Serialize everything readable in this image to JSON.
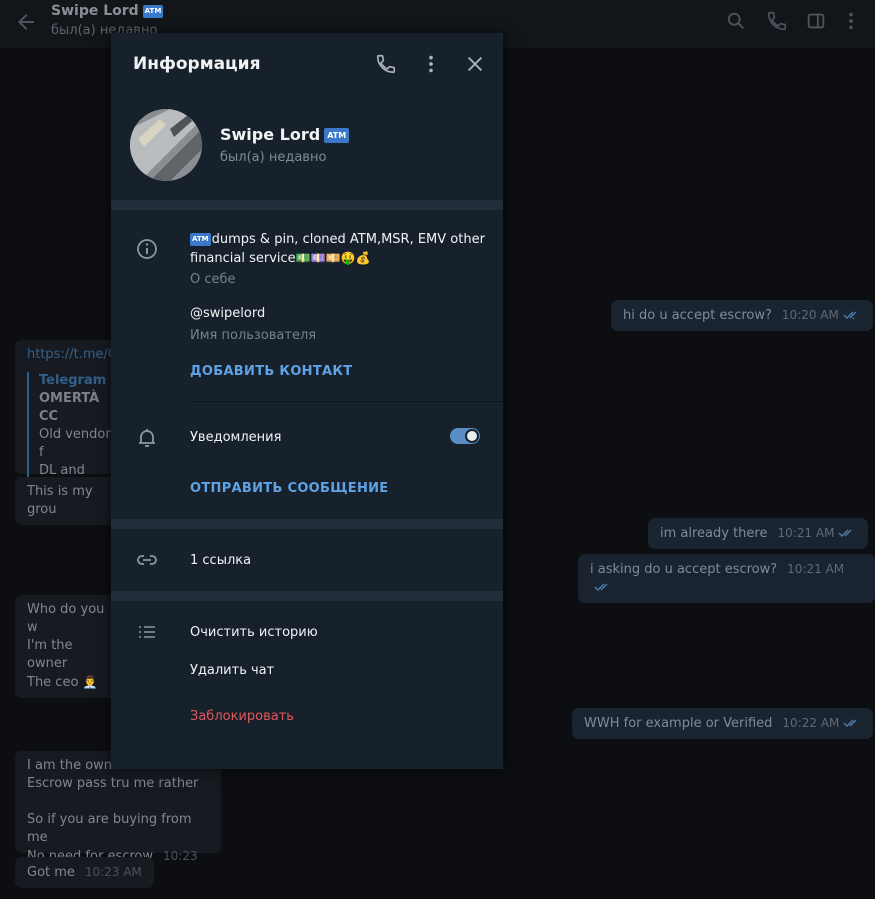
{
  "header": {
    "title": "Swipe Lord",
    "title_badge": "ATM",
    "status": "был(а) недавно",
    "icons": [
      "back-arrow-icon",
      "search-icon",
      "phone-icon",
      "sidebar-icon",
      "more-vertical-icon"
    ]
  },
  "messages": {
    "in": [
      {
        "link": "https://t.me/C",
        "preview_site": "Telegram",
        "preview_title": "OMERTÀ CC",
        "preview_line1": "Old vendor f",
        "preview_line2": "DL and Dum"
      },
      {
        "text": "This is my grou"
      },
      {
        "text": "Who do you w"
      },
      {
        "text": "I'm the owner"
      },
      {
        "text": "The ceo",
        "emoji": "👨‍💼"
      },
      {
        "line1": "I am the owner here",
        "line2": "Escrow pass tru me rather",
        "line3": "So if you are buying from me",
        "line4": "No need for escrow",
        "time": "10:23 AM"
      },
      {
        "text": "Got me",
        "time": "10:23 AM"
      }
    ],
    "out": [
      {
        "text": "hi do u accept escrow?",
        "time": "10:20 AM"
      },
      {
        "text": "im already there",
        "time": "10:21 AM"
      },
      {
        "text": "i asking do u accept escrow?",
        "time": "10:21 AM"
      },
      {
        "text": "WWH for example or Verified",
        "time": "10:22 AM"
      }
    ]
  },
  "panel": {
    "title": "Информация",
    "profile": {
      "name": "Swipe Lord",
      "badge": "ATM",
      "status": "был(а) недавно"
    },
    "bio": {
      "badge": "ATM",
      "text": "dumps & pin, cloned ATM,MSR, EMV other financial service",
      "emojis": "💵💷💴🤑💰",
      "label": "О себе"
    },
    "username": {
      "value": "@swipelord",
      "label": "Имя пользователя"
    },
    "add_contact": "ДОБАВИТЬ КОНТАКТ",
    "notifications": {
      "label": "Уведомления",
      "enabled": true
    },
    "send_message": "ОТПРАВИТЬ СООБЩЕНИЕ",
    "links": "1 ссылка",
    "actions": {
      "clear_history": "Очистить историю",
      "delete_chat": "Удалить чат",
      "block": "Заблокировать"
    }
  },
  "colors": {
    "panel_bg": "#17212b",
    "accent": "#5ea3e6",
    "danger": "#e4565d",
    "separator": "#232e3c"
  }
}
